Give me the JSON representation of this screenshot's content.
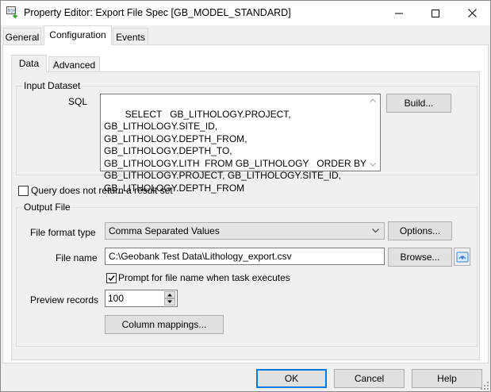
{
  "window": {
    "title": "Property Editor: Export File Spec [GB_MODEL_STANDARD]",
    "icon": "app-property-icon"
  },
  "tabs": [
    {
      "label": "General",
      "active": false
    },
    {
      "label": "Configuration",
      "active": true
    },
    {
      "label": "Events",
      "active": false
    }
  ],
  "inner_tabs": [
    {
      "label": "Data",
      "active": true
    },
    {
      "label": "Advanced",
      "active": false
    }
  ],
  "input_dataset": {
    "group_label": "Input Dataset",
    "sql_label": "SQL",
    "sql_text": "SELECT   GB_LITHOLOGY.PROJECT,  GB_LITHOLOGY.SITE_ID,\nGB_LITHOLOGY.DEPTH_FROM,  GB_LITHOLOGY.DEPTH_TO,\nGB_LITHOLOGY.LITH  FROM GB_LITHOLOGY   ORDER BY\nGB_LITHOLOGY.PROJECT, GB_LITHOLOGY.SITE_ID,\nGB_LITHOLOGY.DEPTH_FROM",
    "build_label": "Build..."
  },
  "query_no_result": {
    "label": "Query does not return a result set",
    "checked": false
  },
  "output_file": {
    "group_label": "Output File",
    "format_label": "File format type",
    "format_value": "Comma Separated Values",
    "options_label": "Options...",
    "filename_label": "File name",
    "filename_value": "C:\\Geobank Test Data\\Lithology_export.csv",
    "browse_label": "Browse...",
    "prompt_label": "Prompt for file name when task executes",
    "prompt_checked": true,
    "preview_label": "Preview records",
    "preview_value": "100",
    "column_mappings_label": "Column mappings..."
  },
  "footer": {
    "ok_label": "OK",
    "cancel_label": "Cancel",
    "help_label": "Help"
  },
  "colors": {
    "accent": "#0078d7",
    "panel": "#f0f0f0",
    "border": "#adadad"
  }
}
